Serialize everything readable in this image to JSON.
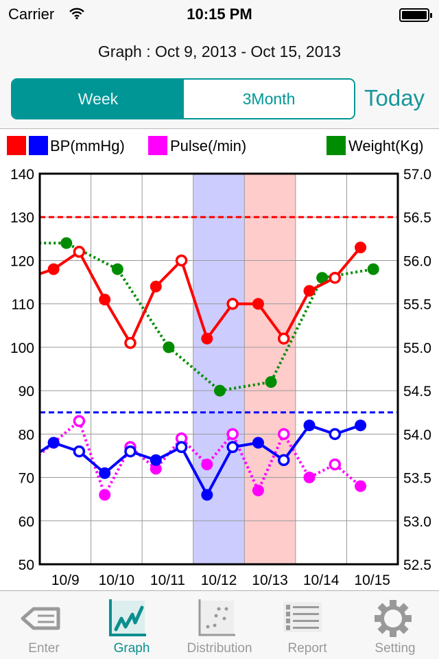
{
  "status": {
    "carrier": "Carrier",
    "time": "10:15 PM"
  },
  "header": {
    "title": "Graph : Oct 9, 2013 - Oct 15, 2013"
  },
  "segmented": {
    "options": [
      "Week",
      "3Month"
    ],
    "selected": "Week"
  },
  "today_label": "Today",
  "legend": {
    "bp": "BP(mmHg)",
    "pulse": "Pulse(/min)",
    "weight": "Weight(Kg)"
  },
  "colors": {
    "accent": "#009696",
    "systolic": "#ff0000",
    "diastolic": "#0000ff",
    "pulse": "#ff00ff",
    "weight": "#008c00",
    "highlight_blue": "#ccccff",
    "highlight_pink": "#ffcccc"
  },
  "chart_data": {
    "type": "line",
    "categories": [
      "10/9",
      "10/10",
      "10/11",
      "10/12",
      "10/13",
      "10/14",
      "10/15"
    ],
    "left_axis": {
      "ylim": [
        50,
        140
      ],
      "ticks": [
        "50",
        "60",
        "70",
        "80",
        "90",
        "100",
        "110",
        "120",
        "130",
        "140"
      ]
    },
    "right_axis": {
      "ylim": [
        52.5,
        57.0
      ],
      "ticks": [
        "52.5",
        "53.0",
        "53.5",
        "54.0",
        "54.5",
        "55.0",
        "55.5",
        "56.0",
        "56.5",
        "57.0"
      ]
    },
    "grid": true,
    "thresholds": [
      {
        "axis": "left",
        "value": 130,
        "color": "#ff0000"
      },
      {
        "axis": "left",
        "value": 85,
        "color": "#0000ff"
      }
    ],
    "highlighted_days": [
      {
        "date": "10/12",
        "color": "#ccccff"
      },
      {
        "date": "10/13",
        "color": "#ffcccc"
      }
    ],
    "series": [
      {
        "key": "weight",
        "axis": "left_weight",
        "style": "dotted",
        "color": "#008c00",
        "points": [
          {
            "date": "10/8",
            "slot": "noon",
            "value": 56.2
          },
          {
            "date": "10/9",
            "slot": "noon",
            "value": 56.2
          },
          {
            "date": "10/10",
            "slot": "noon",
            "value": 55.9
          },
          {
            "date": "10/11",
            "slot": "noon",
            "value": 55.0
          },
          {
            "date": "10/12",
            "slot": "noon",
            "value": 54.5
          },
          {
            "date": "10/13",
            "slot": "noon",
            "value": 54.6
          },
          {
            "date": "10/14",
            "slot": "noon",
            "value": 55.8
          },
          {
            "date": "10/15",
            "slot": "noon",
            "value": 55.9
          }
        ]
      },
      {
        "key": "pulse",
        "style": "dotted",
        "color": "#ff00ff",
        "points": [
          {
            "date": "10/8",
            "slot": "evening",
            "value": 73
          },
          {
            "date": "10/9",
            "slot": "morning",
            "value": 78
          },
          {
            "date": "10/9",
            "slot": "evening",
            "value": 83
          },
          {
            "date": "10/10",
            "slot": "morning",
            "value": 66
          },
          {
            "date": "10/10",
            "slot": "evening",
            "value": 77
          },
          {
            "date": "10/11",
            "slot": "morning",
            "value": 72
          },
          {
            "date": "10/11",
            "slot": "evening",
            "value": 79
          },
          {
            "date": "10/12",
            "slot": "morning",
            "value": 73
          },
          {
            "date": "10/12",
            "slot": "evening",
            "value": 80
          },
          {
            "date": "10/13",
            "slot": "morning",
            "value": 67
          },
          {
            "date": "10/13",
            "slot": "evening",
            "value": 80
          },
          {
            "date": "10/14",
            "slot": "morning",
            "value": 70
          },
          {
            "date": "10/14",
            "slot": "evening",
            "value": 73
          },
          {
            "date": "10/15",
            "slot": "morning",
            "value": 68
          }
        ]
      },
      {
        "key": "diastolic",
        "style": "solid",
        "color": "#0000ff",
        "points": [
          {
            "date": "10/8",
            "slot": "evening",
            "value": 74
          },
          {
            "date": "10/9",
            "slot": "morning",
            "value": 78
          },
          {
            "date": "10/9",
            "slot": "evening",
            "value": 76
          },
          {
            "date": "10/10",
            "slot": "morning",
            "value": 71
          },
          {
            "date": "10/10",
            "slot": "evening",
            "value": 76
          },
          {
            "date": "10/11",
            "slot": "morning",
            "value": 74
          },
          {
            "date": "10/11",
            "slot": "evening",
            "value": 77
          },
          {
            "date": "10/12",
            "slot": "morning",
            "value": 66
          },
          {
            "date": "10/12",
            "slot": "evening",
            "value": 77
          },
          {
            "date": "10/13",
            "slot": "morning",
            "value": 78
          },
          {
            "date": "10/13",
            "slot": "evening",
            "value": 74
          },
          {
            "date": "10/14",
            "slot": "morning",
            "value": 82
          },
          {
            "date": "10/14",
            "slot": "evening",
            "value": 80
          },
          {
            "date": "10/15",
            "slot": "morning",
            "value": 82
          }
        ]
      },
      {
        "key": "systolic",
        "style": "solid",
        "color": "#ff0000",
        "points": [
          {
            "date": "10/8",
            "slot": "evening",
            "value": 116
          },
          {
            "date": "10/9",
            "slot": "morning",
            "value": 118
          },
          {
            "date": "10/9",
            "slot": "evening",
            "value": 122
          },
          {
            "date": "10/10",
            "slot": "morning",
            "value": 111
          },
          {
            "date": "10/10",
            "slot": "evening",
            "value": 101
          },
          {
            "date": "10/11",
            "slot": "morning",
            "value": 114
          },
          {
            "date": "10/11",
            "slot": "evening",
            "value": 120
          },
          {
            "date": "10/12",
            "slot": "morning",
            "value": 102
          },
          {
            "date": "10/12",
            "slot": "evening",
            "value": 110
          },
          {
            "date": "10/13",
            "slot": "morning",
            "value": 110
          },
          {
            "date": "10/13",
            "slot": "evening",
            "value": 102
          },
          {
            "date": "10/14",
            "slot": "morning",
            "value": 113
          },
          {
            "date": "10/14",
            "slot": "evening",
            "value": 116
          },
          {
            "date": "10/15",
            "slot": "morning",
            "value": 123
          }
        ]
      }
    ]
  },
  "tabbar": {
    "items": [
      {
        "label": "Enter",
        "icon": "enter-icon"
      },
      {
        "label": "Graph",
        "icon": "graph-icon"
      },
      {
        "label": "Distribution",
        "icon": "distribution-icon"
      },
      {
        "label": "Report",
        "icon": "report-icon"
      },
      {
        "label": "Setting",
        "icon": "gear-icon"
      }
    ],
    "active": "Graph"
  }
}
